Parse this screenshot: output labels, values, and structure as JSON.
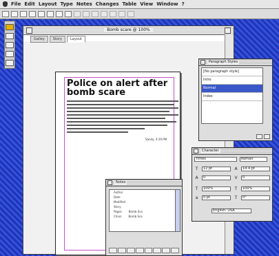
{
  "menubar": {
    "items": [
      "File",
      "Edit",
      "Layout",
      "Type",
      "Notes",
      "Changes",
      "Table",
      "View",
      "Window",
      "?"
    ]
  },
  "document": {
    "title": "Bomb scare @ 100%",
    "tabs": [
      "Galley",
      "Story",
      "Layout"
    ],
    "active_tab": "Layout",
    "headline": "Police on alert after bomb scare",
    "byline": "Sandy, 4:19 PM"
  },
  "paragraph_styles": {
    "title": "Paragraph Styles",
    "items": [
      "[No paragraph style]",
      "Intro",
      "Normal",
      "Index"
    ],
    "selected_index": 2
  },
  "character": {
    "title": "Character",
    "font": "Times",
    "style": "Roman",
    "size": "12 pt",
    "leading": "14.4 pt",
    "tracking": "0",
    "kerning": "0",
    "scale_v": "100%",
    "scale_h": "100%",
    "baseline": "0 pt",
    "skew": "0°",
    "language": "English: USA"
  },
  "notes": {
    "title": "Notes",
    "items": [
      {
        "name": "Author",
        "value": ""
      },
      {
        "name": "Date",
        "value": ""
      },
      {
        "name": "Modified",
        "value": ""
      },
      {
        "name": "Story",
        "value": ""
      },
      {
        "name": "Pages",
        "value": "Bomb Sca"
      },
      {
        "name": "Chars",
        "value": "Bomb Sca"
      }
    ]
  }
}
